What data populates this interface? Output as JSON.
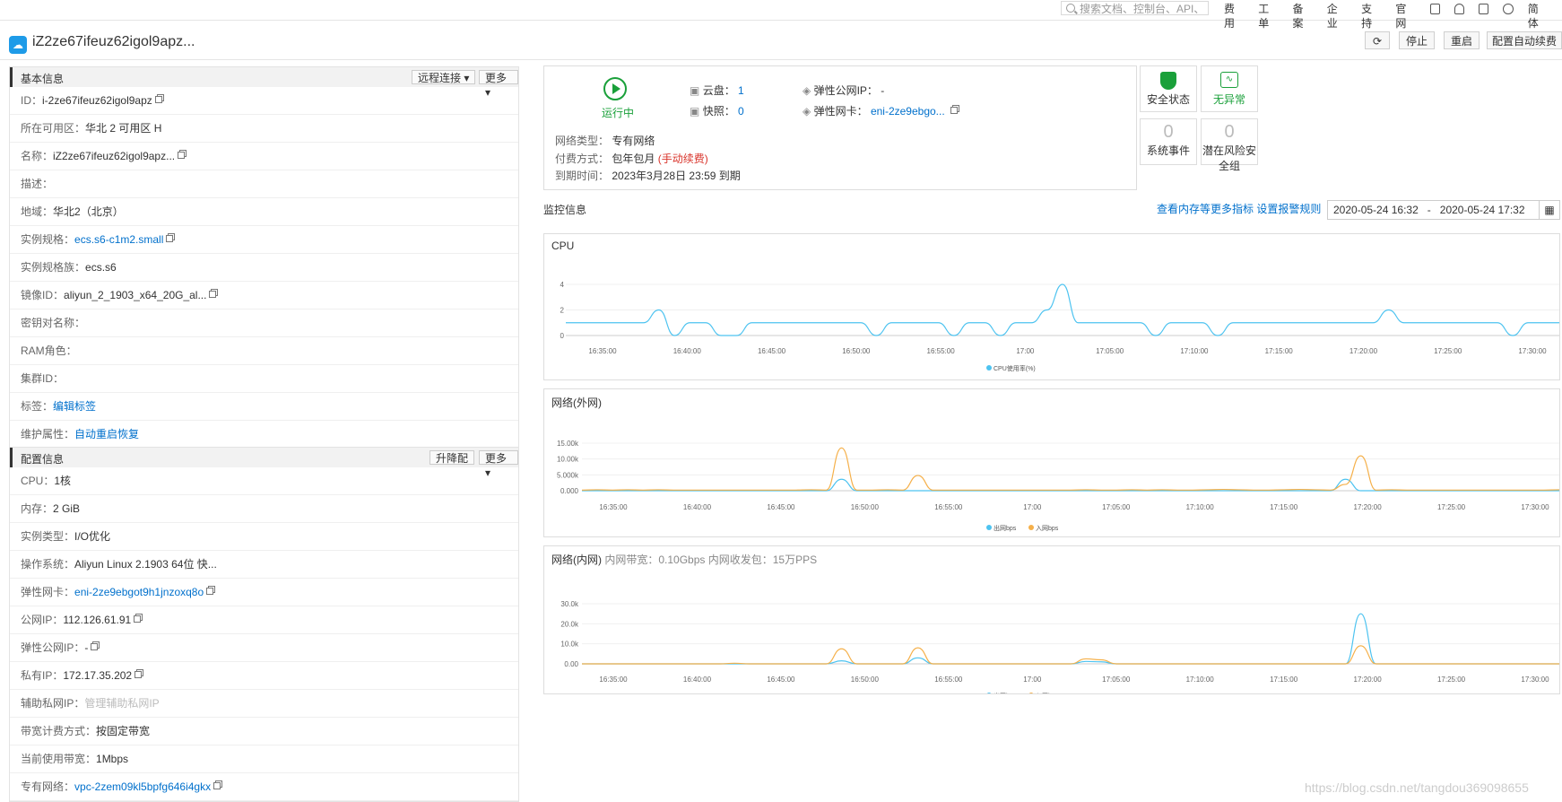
{
  "topbar": {
    "search_placeholder": "搜索文档、控制台、API、",
    "nav": [
      "费用",
      "工单",
      "备案",
      "企业",
      "支持",
      "官网"
    ],
    "lang": "简体"
  },
  "header": {
    "title": "iZ2ze67ifeuz62igol9apz...",
    "buttons": [
      "停止",
      "重启",
      "配置自动续费"
    ]
  },
  "basic": {
    "title": "基本信息",
    "btn_remote": "远程连接 ▾",
    "btn_more": "更多▾",
    "rows": [
      {
        "k": "ID：",
        "v": "i-2ze67ifeuz62igol9apz"
      },
      {
        "k": "所在可用区：",
        "v": "华北 2 可用区 H"
      },
      {
        "k": "名称：",
        "v": "iZ2ze67ifeuz62igol9apz..."
      },
      {
        "k": "描述：",
        "v": ""
      },
      {
        "k": "地域：",
        "v": "华北2（北京）"
      },
      {
        "k": "实例规格：",
        "v": "ecs.s6-c1m2.small"
      },
      {
        "k": "实例规格族：",
        "v": "ecs.s6"
      },
      {
        "k": "镜像ID：",
        "v": "aliyun_2_1903_x64_20G_al..."
      },
      {
        "k": "密钥对名称：",
        "v": ""
      },
      {
        "k": "RAM角色：",
        "v": ""
      },
      {
        "k": "集群ID：",
        "v": ""
      },
      {
        "k": "标签：",
        "v": "编辑标签"
      },
      {
        "k": "维护属性：",
        "v": "自动重启恢复"
      }
    ]
  },
  "config": {
    "title": "配置信息",
    "btn_upgrade": "升降配",
    "btn_more": "更多▾",
    "rows": [
      {
        "k": "CPU：",
        "v": "1核"
      },
      {
        "k": "内存：",
        "v": "2 GiB"
      },
      {
        "k": "实例类型：",
        "v": "I/O优化"
      },
      {
        "k": "操作系统：",
        "v": "Aliyun Linux 2.1903 64位 快..."
      },
      {
        "k": "弹性网卡：",
        "v": "eni-2ze9ebgot9h1jnzoxq8o"
      },
      {
        "k": "公网IP：",
        "v": "112.126.61.91"
      },
      {
        "k": "弹性公网IP：",
        "v": "-"
      },
      {
        "k": "私有IP：",
        "v": "172.17.35.202"
      },
      {
        "k": "辅助私网IP：",
        "v": "管理辅助私网IP"
      },
      {
        "k": "带宽计费方式：",
        "v": "按固定带宽"
      },
      {
        "k": "当前使用带宽：",
        "v": "1Mbps"
      },
      {
        "k": "专有网络：",
        "v": "vpc-2zem09kl5bpfg646i4gkx"
      }
    ]
  },
  "status": {
    "running": "运行中",
    "disk_label": "云盘：",
    "disk_val": "1",
    "snap_label": "快照：",
    "snap_val": "0",
    "eip_label": "弹性公网IP：",
    "eip_val": "-",
    "eni_label": "弹性网卡：",
    "eni_val": "eni-2ze9ebgo...",
    "net_type_label": "网络类型：",
    "net_type_val": "专有网络",
    "pay_label": "付费方式：",
    "pay_val": "包年包月",
    "pay_renew": "(手动续费)",
    "expire_label": "到期时间：",
    "expire_val": "2023年3月28日 23:59 到期"
  },
  "tiles": {
    "security": "安全状态",
    "normal": "无异常",
    "sys_events": "系统事件",
    "sys_events_n": "0",
    "risk_sg_line1": "潜在风险安",
    "risk_sg_line2": "全组",
    "risk_sg_n": "0"
  },
  "monitor": {
    "title": "监控信息",
    "link1": "查看内存等更多指标",
    "link2": "设置报警规则",
    "date_from": "2020-05-24 16:32",
    "date_sep": "-",
    "date_to": "2020-05-24 17:32"
  },
  "watermark": "https://blog.csdn.net/tangdou369098655",
  "colors": {
    "blue": "#4dc3f0",
    "orange": "#f5b04a",
    "link": "#0070cc",
    "green": "#1aa03a"
  },
  "chart_data": [
    {
      "type": "line",
      "title": "CPU",
      "x": [
        "16:35:00",
        "16:40:00",
        "16:45:00",
        "16:50:00",
        "16:55:00",
        "17:00",
        "17:05:00",
        "17:10:00",
        "17:15:00",
        "17:20:00",
        "17:25:00",
        "17:30:00"
      ],
      "yticks": [
        "0",
        "2",
        "4"
      ],
      "ylim": [
        0,
        4
      ],
      "series": [
        {
          "name": "CPU使用率(%)",
          "color": "#4dc3f0",
          "values": [
            1,
            1,
            1,
            1,
            1,
            1,
            2,
            0,
            1,
            1,
            0,
            0,
            1,
            1,
            1,
            1,
            1,
            1,
            1,
            1,
            0,
            1,
            1,
            1,
            1,
            0,
            1,
            1,
            0,
            1,
            1,
            2,
            4,
            1,
            1,
            1,
            1,
            1,
            0,
            1,
            1,
            1,
            0,
            1,
            1,
            1,
            1,
            1,
            1,
            1,
            1,
            1,
            1,
            2,
            1,
            1,
            1,
            1,
            1,
            1,
            1,
            0,
            1,
            1,
            1
          ]
        }
      ]
    },
    {
      "type": "line",
      "title": "网络(外网)",
      "x": [
        "16:35:00",
        "16:40:00",
        "16:45:00",
        "16:50:00",
        "16:55:00",
        "17:00",
        "17:05:00",
        "17:10:00",
        "17:15:00",
        "17:20:00",
        "17:25:00",
        "17:30:00"
      ],
      "yticks": [
        "0.000",
        "5.000k",
        "10.00k",
        "15.00k"
      ],
      "ylim": [
        0,
        15000
      ],
      "series": [
        {
          "name": "出网bps",
          "color": "#4dc3f0",
          "values": [
            0,
            0,
            0,
            0,
            0,
            0,
            0,
            0,
            0,
            0,
            0,
            0,
            0,
            0,
            0,
            0,
            0,
            3600,
            0,
            0,
            0,
            0,
            0,
            0,
            0,
            0,
            0,
            0,
            0,
            0,
            0,
            0,
            0,
            0,
            0,
            0,
            0,
            0,
            0,
            0,
            0,
            0,
            0,
            0,
            0,
            0,
            0,
            0,
            0,
            0,
            3600,
            0,
            0,
            0,
            0,
            0,
            0,
            0,
            0,
            0,
            0,
            0,
            0,
            0,
            0
          ]
        },
        {
          "name": "入网bps",
          "color": "#f5b04a",
          "values": [
            200,
            300,
            200,
            300,
            200,
            300,
            200,
            200,
            200,
            200,
            200,
            200,
            200,
            200,
            200,
            300,
            200,
            13500,
            200,
            200,
            300,
            200,
            4800,
            200,
            200,
            200,
            200,
            200,
            200,
            200,
            200,
            200,
            200,
            300,
            200,
            200,
            300,
            200,
            300,
            200,
            200,
            300,
            400,
            300,
            200,
            200,
            300,
            400,
            300,
            200,
            2000,
            11000,
            200,
            300,
            200,
            200,
            200,
            200,
            200,
            200,
            200,
            200,
            200,
            200,
            300
          ]
        }
      ]
    },
    {
      "type": "line",
      "title": "网络(内网)",
      "subtitle": "内网带宽：0.10Gbps 内网收发包：15万PPS",
      "x": [
        "16:35:00",
        "16:40:00",
        "16:45:00",
        "16:50:00",
        "16:55:00",
        "17:00",
        "17:05:00",
        "17:10:00",
        "17:15:00",
        "17:20:00",
        "17:25:00",
        "17:30:00"
      ],
      "yticks": [
        "0.00",
        "10.0k",
        "20.0k",
        "30.0k"
      ],
      "ylim": [
        0,
        30000
      ],
      "series": [
        {
          "name": "出网bps",
          "color": "#4dc3f0",
          "values": [
            0,
            0,
            0,
            0,
            0,
            0,
            0,
            0,
            0,
            0,
            0,
            0,
            0,
            0,
            0,
            0,
            0,
            1500,
            0,
            0,
            0,
            0,
            3000,
            0,
            0,
            0,
            0,
            0,
            0,
            0,
            0,
            0,
            0,
            1200,
            1000,
            0,
            0,
            0,
            0,
            0,
            0,
            0,
            0,
            0,
            0,
            0,
            0,
            0,
            0,
            0,
            0,
            25000,
            0,
            0,
            0,
            0,
            0,
            0,
            0,
            0,
            0,
            0,
            0,
            0,
            0
          ]
        },
        {
          "name": "入网bps",
          "color": "#f5b04a",
          "values": [
            0,
            0,
            0,
            0,
            0,
            0,
            0,
            0,
            0,
            0,
            300,
            0,
            0,
            0,
            0,
            0,
            0,
            7500,
            0,
            0,
            0,
            0,
            8000,
            0,
            0,
            0,
            0,
            0,
            0,
            0,
            0,
            0,
            0,
            2500,
            2000,
            0,
            0,
            0,
            0,
            0,
            0,
            0,
            0,
            0,
            0,
            0,
            0,
            0,
            0,
            0,
            0,
            9000,
            0,
            0,
            0,
            0,
            0,
            0,
            0,
            0,
            0,
            0,
            0,
            0,
            0
          ]
        }
      ]
    }
  ]
}
